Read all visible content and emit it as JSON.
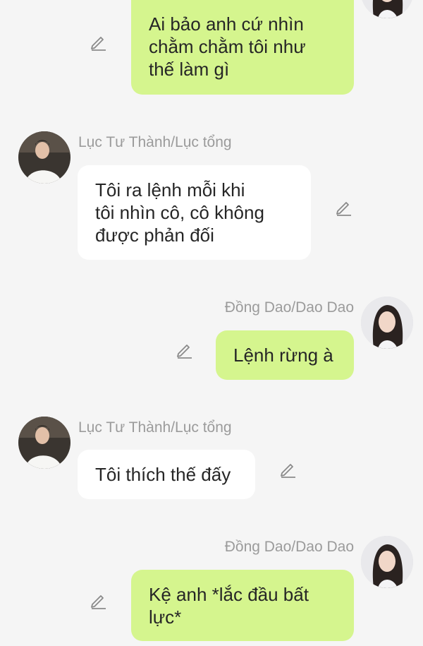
{
  "colors": {
    "background": "#f5f5f5",
    "bubble_self": "#d5f58e",
    "bubble_other": "#ffffff",
    "name_text": "#9b9b9b"
  },
  "icons": {
    "edit": "pencil-icon"
  },
  "messages": [
    {
      "side": "right",
      "sender": "",
      "text": "Ai bảo anh cứ nhìn\nchằm chằm tôi như\nthế làm gì"
    },
    {
      "side": "left",
      "sender": "Lục Tư Thành/Lục tổng",
      "text": "Tôi ra lệnh mỗi khi\ntôi nhìn cô, cô không\nđược phản đối"
    },
    {
      "side": "right",
      "sender": "Đồng Dao/Dao Dao",
      "text": "Lệnh rừng à"
    },
    {
      "side": "left",
      "sender": "Lục Tư Thành/Lục tổng",
      "text": "Tôi thích thế đấy"
    },
    {
      "side": "right",
      "sender": "Đồng Dao/Dao Dao",
      "text": "Kệ anh *lắc đầu bất\nlực*"
    }
  ]
}
